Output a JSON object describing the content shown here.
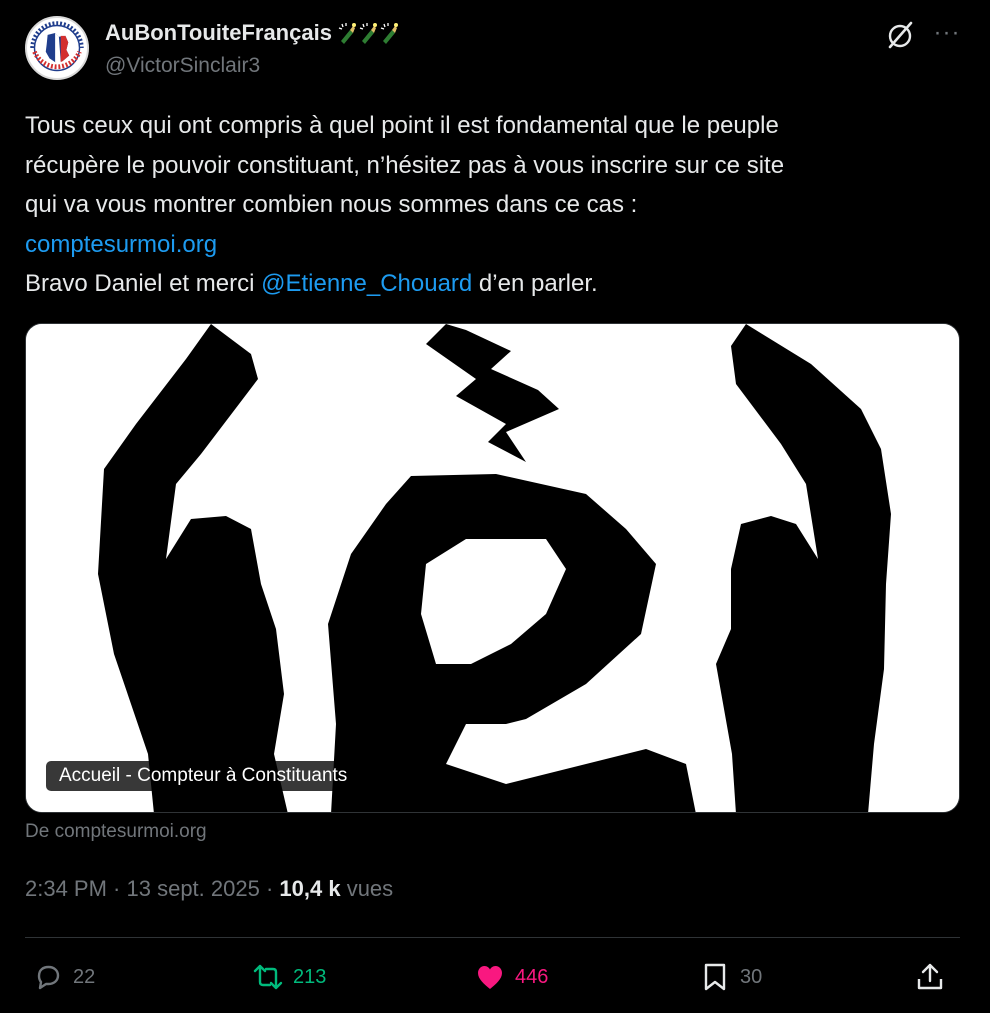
{
  "author": {
    "display_name": "AuBonTouiteFrançais",
    "handle": "@VictorSinclair3",
    "avatar_text": "MADE IN FRANCE · FABRICATION FRANÇAISE",
    "emoji_names": [
      "champagne-bottle-icon",
      "champagne-bottle-icon",
      "champagne-bottle-icon"
    ]
  },
  "tweet": {
    "line1": "Tous ceux qui ont compris à quel point il est fondamental que le peuple",
    "line2": "récupère le pouvoir constituant, n’hésitez pas à vous inscrire sur ce site",
    "line3": "qui va vous montrer combien nous sommes dans ce cas :",
    "link": "comptesurmoi.org",
    "line5_prefix": "Bravo Daniel et merci ",
    "mention": "@Etienne_Chouard",
    "line5_suffix": " d’en parler."
  },
  "card": {
    "title": "Accueil - Compteur à Constituants",
    "source": "De comptesurmoi.org"
  },
  "meta": {
    "time": "2:34 PM",
    "sep1": " · ",
    "date": "13 sept. 2025",
    "sep2": " · ",
    "views_count": "10,4 k",
    "views_label": " vues"
  },
  "actions": {
    "replies": "22",
    "retweets": "213",
    "likes": "446",
    "bookmarks": "30"
  },
  "colors": {
    "background": "#000000",
    "text": "#e7e9ea",
    "secondary": "#71767b",
    "link": "#1d9bf0",
    "retweet_active": "#00ba7c",
    "like_active": "#f91880"
  }
}
